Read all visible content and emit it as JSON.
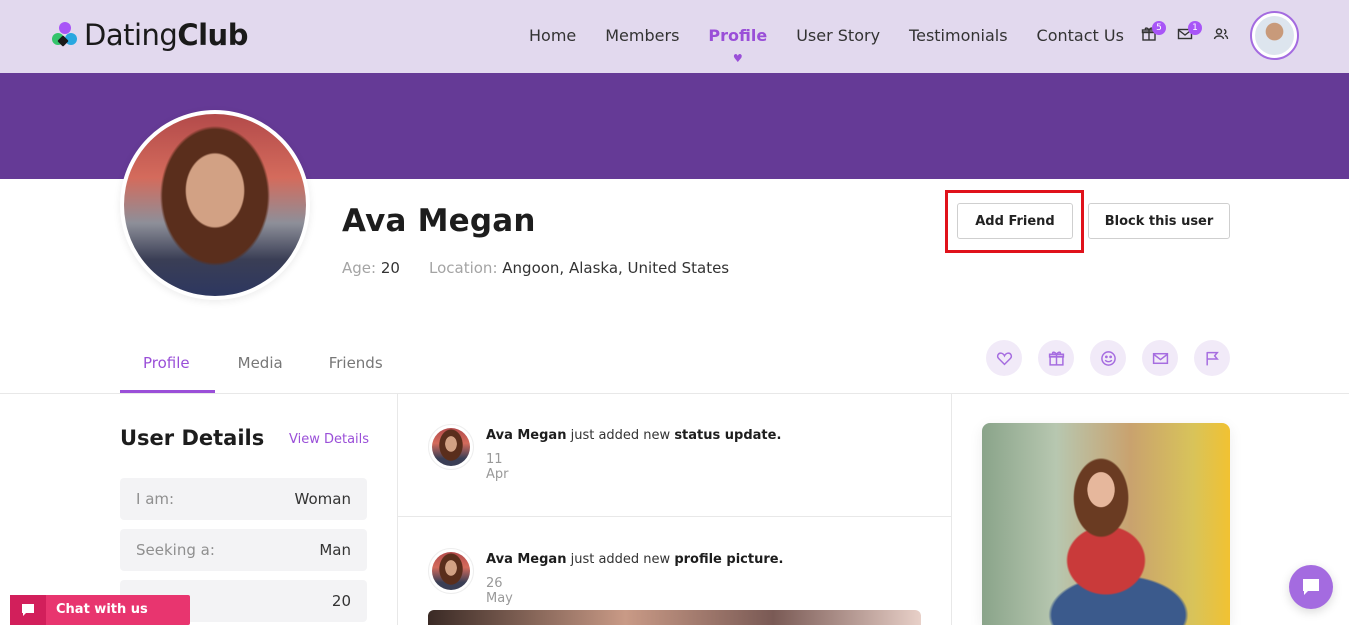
{
  "brand": {
    "name_light": "Dating",
    "name_bold": "Club"
  },
  "nav": {
    "items": [
      {
        "label": "Home",
        "active": false
      },
      {
        "label": "Members",
        "active": false
      },
      {
        "label": "Profile",
        "active": true
      },
      {
        "label": "User Story",
        "active": false
      },
      {
        "label": "Testimonials",
        "active": false
      },
      {
        "label": "Contact Us",
        "active": false
      }
    ],
    "gift_badge": "5",
    "mail_badge": "1",
    "icons": [
      "gift-icon",
      "mail-icon",
      "users-icon"
    ]
  },
  "profile": {
    "name": "Ava Megan",
    "age_label": "Age:",
    "age": "20",
    "location_label": "Location:",
    "location": "Angoon, Alaska, United States",
    "add_friend": "Add Friend",
    "block_user": "Block this user"
  },
  "tabs": [
    {
      "label": "Profile",
      "active": true
    },
    {
      "label": "Media",
      "active": false
    },
    {
      "label": "Friends",
      "active": false
    }
  ],
  "actions": [
    "heart-icon",
    "gift-icon",
    "smile-icon",
    "mail-icon",
    "flag-icon"
  ],
  "user_details": {
    "title": "User Details",
    "link": "View Details",
    "rows": [
      {
        "key": "I am:",
        "value": "Woman"
      },
      {
        "key": "Seeking a:",
        "value": "Man"
      },
      {
        "key": "",
        "value": "20"
      }
    ]
  },
  "feed": [
    {
      "name": "Ava Megan",
      "mid": " just added new ",
      "what": "status update.",
      "date": "11 Apr"
    },
    {
      "name": "Ava Megan",
      "mid": " just added new ",
      "what": "profile picture.",
      "date": "26 May"
    }
  ],
  "chat": {
    "label": "Chat with us"
  },
  "colors": {
    "accent": "#9a4fd8",
    "banner": "#653a96",
    "header_bg": "#e2d9ee",
    "chat": "#e8356f",
    "highlight": "#e0121b"
  }
}
